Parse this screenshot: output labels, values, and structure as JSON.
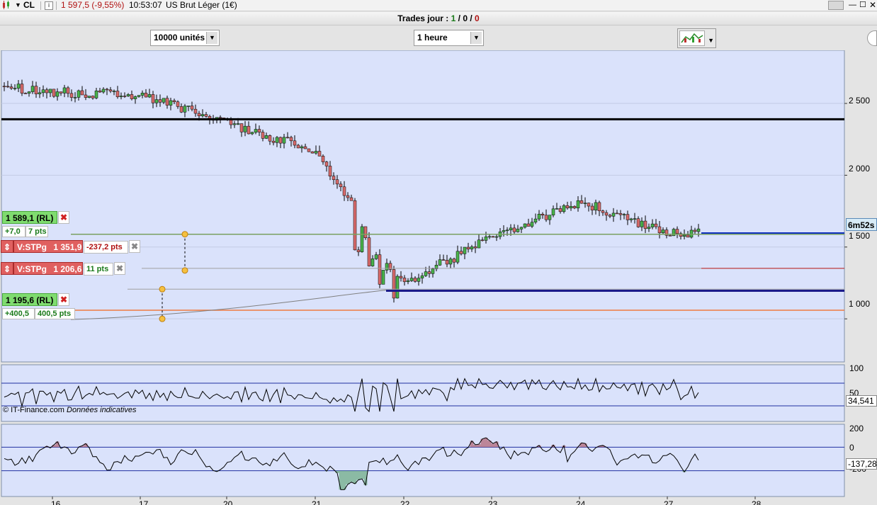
{
  "titlebar": {
    "symbol": "CL",
    "price": "1 597,5 (-9,55%)",
    "time": "10:53:07",
    "name": "US Brut Léger (1€)"
  },
  "trades": {
    "label": "Trades jour :",
    "v1": "1",
    "sep1": " / ",
    "v2": "0",
    "sep2": " / ",
    "v3": "0"
  },
  "controls": {
    "units": "10000 unités",
    "period": "1 heure"
  },
  "countdown": "6m52s",
  "copyright": "© IT-Finance.com",
  "disclaimer": "Données indicatives",
  "price_axis": [
    "2 500",
    "2 000",
    "1 500",
    "1 000"
  ],
  "osc1_axis": [
    "100",
    "50"
  ],
  "osc1_value": "34,541",
  "osc2_axis": [
    "200",
    "0",
    "-200"
  ],
  "osc2_value": "-137,28",
  "date_axis": [
    "16",
    "17",
    "20",
    "21",
    "22",
    "23",
    "24",
    "27",
    "28"
  ],
  "orders": {
    "rl1": {
      "label": "1 589,1 (RL)",
      "pts_val": "+7,0",
      "pts": "7 pts"
    },
    "stp1": {
      "label": "V:STPg",
      "price": "1 351,9",
      "pts": "-237,2 pts"
    },
    "stp2": {
      "label": "V:STPg",
      "price": "1 206,6",
      "pts": "11 pts"
    },
    "rl2": {
      "label": "1 195,6 (RL)",
      "pts_val": "+400,5",
      "pts": "400,5 pts"
    }
  },
  "icons": {
    "chart_type": "candlestick-chart-icon"
  },
  "chart_data": {
    "type": "candlestick",
    "x": [
      "16",
      "17",
      "20",
      "21",
      "22",
      "23",
      "24",
      "27"
    ],
    "close": [
      2580,
      2560,
      2360,
      2170,
      1250,
      1560,
      1820,
      1597.5
    ],
    "ylim": [
      700,
      2870
    ],
    "hlines": [
      2390,
      1589.1,
      1351.9,
      1206.6,
      1195.6,
      1060
    ]
  }
}
